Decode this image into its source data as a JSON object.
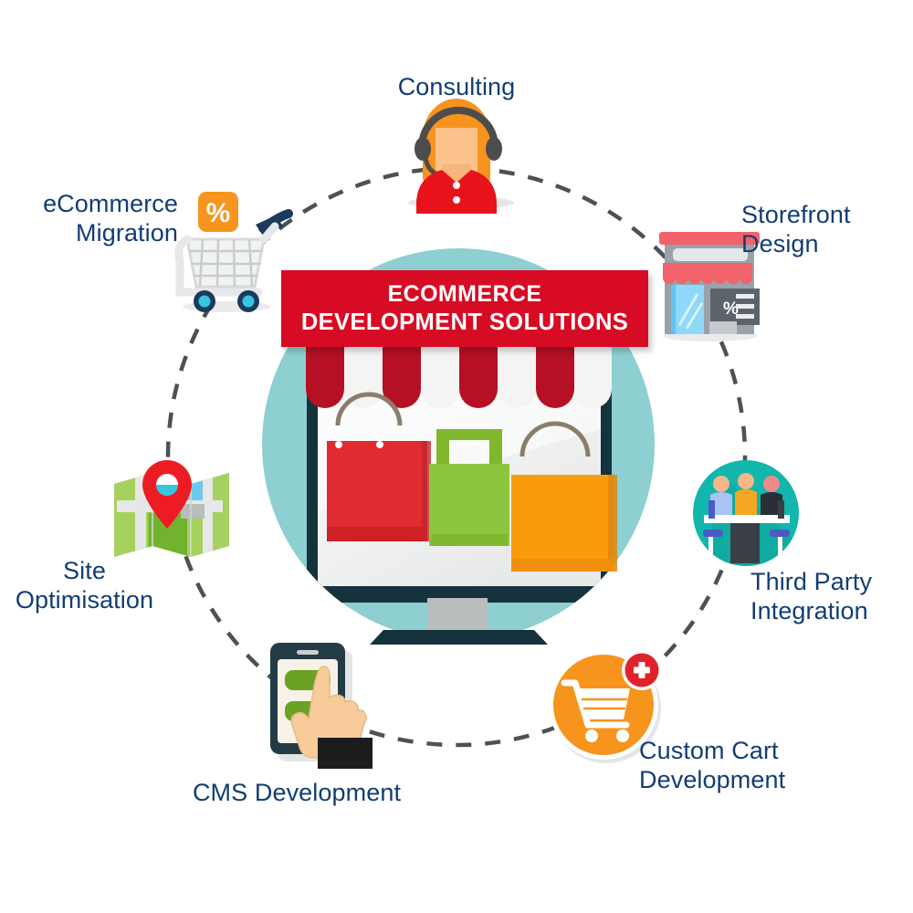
{
  "diagram": {
    "type": "circular-hub-and-spoke",
    "center": {
      "banner_line1": "ECOMMERCE",
      "banner_line2": "DEVELOPMENT SOLUTIONS",
      "icon": "online-storefront-monitor-icon",
      "description": "Desktop monitor displaying a shop with a red and white striped awning and three shopping bags"
    },
    "nodes": [
      {
        "id": "consulting",
        "label": "Consulting",
        "icon": "headset-support-agent-icon",
        "angle_deg": 90
      },
      {
        "id": "storefront-design",
        "label": "Storefront\nDesign",
        "icon": "shop-building-icon",
        "angle_deg": 45
      },
      {
        "id": "third-party-integration",
        "label": "Third Party\nIntegration",
        "icon": "meeting-table-people-icon",
        "angle_deg": 340
      },
      {
        "id": "custom-cart-development",
        "label": "Custom Cart\nDevelopment",
        "icon": "shopping-cart-plus-icon",
        "angle_deg": 300
      },
      {
        "id": "cms-development",
        "label": "CMS Development",
        "icon": "tablet-hand-tap-icon",
        "angle_deg": 255
      },
      {
        "id": "site-optimisation",
        "label": "Site\nOptimisation",
        "icon": "map-location-pin-icon",
        "angle_deg": 195
      },
      {
        "id": "ecommerce-migration",
        "label": "eCommerce\nMigration",
        "icon": "shopping-cart-discount-icon",
        "angle_deg": 145
      }
    ],
    "connector": {
      "style": "dashed-circle",
      "color": "#4b5256"
    }
  },
  "colors": {
    "banner_red": "#d80b24",
    "awning_red": "#b51024",
    "label_navy": "#123d72",
    "hub_teal": "#8ecfd1",
    "monitor_navy": "#16323c",
    "bag_red": "#e02b30",
    "bag_green": "#8cc63e",
    "bag_orange": "#f89c0e",
    "accent_orange": "#f7941e",
    "accent_cyan": "#37c6e0",
    "dash_grey": "#4b5256"
  }
}
